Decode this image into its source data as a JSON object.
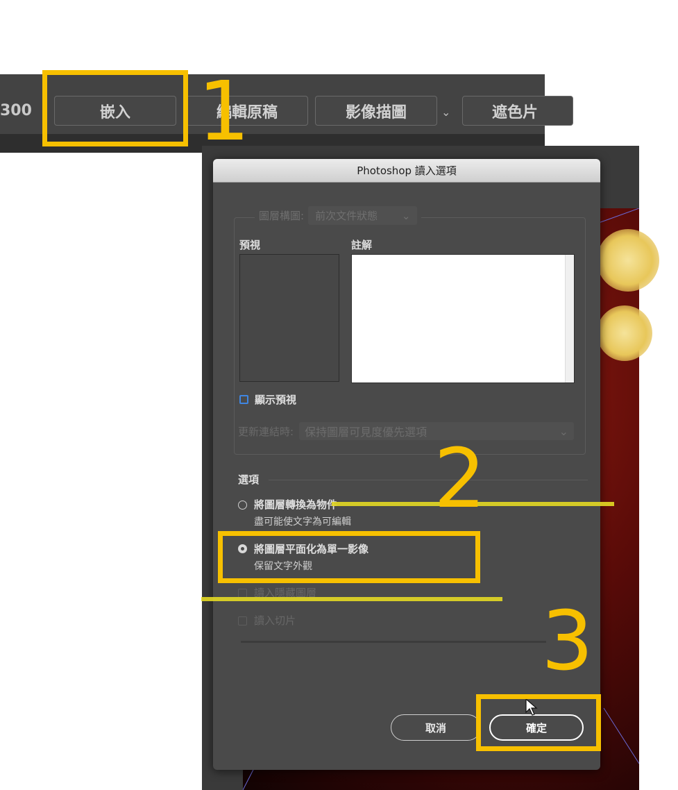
{
  "toolbar": {
    "partial_number": "300",
    "embed_label": "嵌入",
    "edit_original_label": "編輯原稿",
    "image_trace_label": "影像描圖",
    "dropdown_glyph": "⌄",
    "mask_label": "遮色片"
  },
  "dialog": {
    "title": "Photoshop 讀入選項",
    "layer_comp_label": "圖層構圖:",
    "layer_comp_value": "前次文件狀態",
    "preview_label": "預視",
    "notes_label": "註解",
    "show_preview_label": "顯示預視",
    "update_links_label": "更新連結時:",
    "update_links_value": "保持圖層可見度優先選項",
    "options_label": "選項",
    "option_convert": "將圖層轉換為物件",
    "option_convert_sub": "盡可能使文字為可編輯",
    "option_flatten": "將圖層平面化為單一影像",
    "option_flatten_sub": "保留文字外觀",
    "import_hidden_layers": "讀入隱藏圖層",
    "import_slices": "讀入切片",
    "cancel_label": "取消",
    "ok_label": "確定",
    "selected_option": "option_flatten"
  },
  "annotations": {
    "step1": "1",
    "step2": "2",
    "step3": "3",
    "color": "#f7c000"
  }
}
